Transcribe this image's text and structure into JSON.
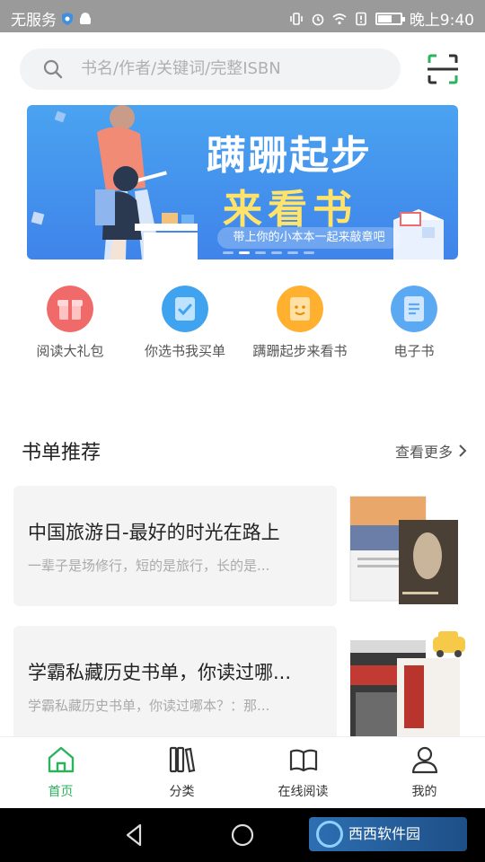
{
  "status_bar": {
    "carrier": "无服务",
    "time": "晚上9:40"
  },
  "search": {
    "placeholder": "书名/作者/关键词/完整ISBN"
  },
  "banner": {
    "title": "蹒跚起步",
    "subtitle": "来看书",
    "caption": "带上你的小本本一起来敲章吧"
  },
  "quick_entries": [
    {
      "label": "阅读大礼包",
      "icon": "gift-icon",
      "color": "#f06a6a"
    },
    {
      "label": "你选书我买单",
      "icon": "book-check-icon",
      "color": "#3fa3f0"
    },
    {
      "label": "蹒跚起步来看书",
      "icon": "book-smile-icon",
      "color": "#ffb02e"
    },
    {
      "label": "电子书",
      "icon": "ebook-icon",
      "color": "#5aa9f2"
    }
  ],
  "section": {
    "title": "书单推荐",
    "more": "查看更多"
  },
  "booklists": [
    {
      "title": "中国旅游日-最好的时光在路上",
      "desc": "一辈子是场修行，短的是旅行，长的是..."
    },
    {
      "title": "学霸私藏历史书单，你读过哪...",
      "desc": "学霸私藏历史书单，你读过哪本？：那..."
    }
  ],
  "bottom_nav": [
    {
      "label": "首页",
      "icon": "home-icon",
      "active": true
    },
    {
      "label": "分类",
      "icon": "category-books-icon",
      "active": false
    },
    {
      "label": "在线阅读",
      "icon": "open-book-icon",
      "active": false
    },
    {
      "label": "我的",
      "icon": "user-icon",
      "active": false
    }
  ],
  "watermark": {
    "text": "西西软件园"
  },
  "colors": {
    "accent": "#2bb35c",
    "banner_blue": "#3f84ea",
    "status_gray": "#9a9a9a"
  }
}
